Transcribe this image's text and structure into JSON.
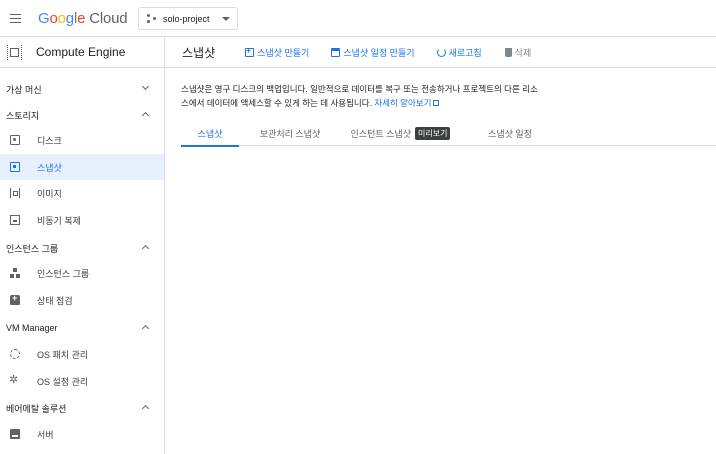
{
  "header": {
    "logo_google": "Google",
    "logo_cloud": "Cloud",
    "project": "solo-project"
  },
  "sidebar": {
    "product_title": "Compute Engine",
    "sections": [
      {
        "label": "가상 머신",
        "state": "collapsed"
      },
      {
        "label": "스토리지",
        "state": "expanded"
      },
      {
        "label": "인스턴스 그룹",
        "state": "expanded"
      },
      {
        "label": "VM Manager",
        "state": "expanded"
      },
      {
        "label": "베어메탈 솔루션",
        "state": "expanded"
      }
    ],
    "items": [
      {
        "label": "디스크",
        "icon": "disk-icon"
      },
      {
        "label": "스냅샷",
        "icon": "snapshot-icon",
        "active": true
      },
      {
        "label": "이미지",
        "icon": "image-icon"
      },
      {
        "label": "비동기 복제",
        "icon": "async-replication-icon"
      },
      {
        "label": "인스턴스 그룹",
        "icon": "instance-group-icon"
      },
      {
        "label": "상태 점검",
        "icon": "health-check-icon"
      },
      {
        "label": "OS 패치 관리",
        "icon": "os-patch-icon"
      },
      {
        "label": "OS 설정 관리",
        "icon": "os-config-icon"
      },
      {
        "label": "서버",
        "icon": "server-icon"
      }
    ]
  },
  "main": {
    "title": "스냅샷",
    "actions": [
      {
        "label": "스냅샷 만들기",
        "icon": "add-box-icon"
      },
      {
        "label": "스냅샷 일정 만들기",
        "icon": "calendar-icon"
      },
      {
        "label": "새로고침",
        "icon": "refresh-icon"
      },
      {
        "label": "삭제",
        "icon": "delete-icon",
        "disabled": true
      }
    ],
    "description": "스냅샷은 영구 디스크의 백업입니다. 일반적으로 데이터를 복구 또는 전송하거나 프로젝트의 다른 리소스에서 데이터에 액세스할 수 있게 하는 데 사용됩니다.",
    "learn_more": "자세히 알아보기",
    "tabs": [
      {
        "label": "스냅샷",
        "active": true
      },
      {
        "label": "보관처리 스냅샷"
      },
      {
        "label": "인스턴트 스냅샷",
        "badge": "미리보기"
      },
      {
        "label": "스냅샷 일정"
      }
    ]
  },
  "colors": {
    "accent": "#1a73e8",
    "active_bg": "#e8f0fe",
    "badge_bg": "#3c4043",
    "border": "#dadce0"
  }
}
